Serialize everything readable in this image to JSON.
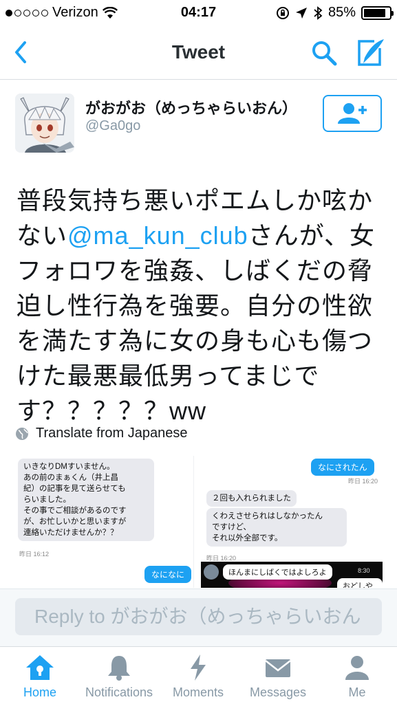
{
  "status_bar": {
    "carrier": "Verizon",
    "time": "04:17",
    "battery": "85%",
    "battery_level": 0.85
  },
  "nav": {
    "title": "Tweet"
  },
  "tweet": {
    "author_name": "がおがお（めっちゃらいおん）",
    "author_handle": "@Ga0go",
    "text_line1": "普段気持ち悪いポエムしか呟か",
    "text_line2_prefix": "ない",
    "mention": "@ma_kun_club",
    "text_line2_suffix": "さんが、女",
    "text_line3": "フォロワを強姦、しばくだの脅",
    "text_line4": "迫し性行為を強要。自分の性欲",
    "text_line5": "を満たす為に女の身も心も傷つ",
    "text_line6": "けた最悪最低男ってまじで",
    "text_line7": "す？？？？？ww",
    "translate_label": "Translate from Japanese"
  },
  "media": {
    "left_bubble_lines": [
      "いきなりDMすいません。",
      "あの前のまぁくん（井上昌",
      "紀）の記事を見て送らせても",
      "らいました。",
      "その事でご相談があるのです",
      "が、お忙しいかと思いますが",
      "連絡いただけませんか？？"
    ],
    "left_timestamp": "昨日 16:12",
    "left_reply": "なになに",
    "right_top_reply": "なにされたん",
    "right_timestamp1": "昨日 16:20",
    "right_bubble1": "２回も入れられました",
    "right_bubble2_lines": [
      "くわえさせられはしなかったん",
      "ですけど、",
      "それ以外全部です。"
    ],
    "right_timestamp2": "昨日 16:20",
    "dark_bubble": "ほんまにしばくではよしろよ",
    "dark_time": "8:30",
    "dark_bubble2": "おどしやん。"
  },
  "reply": {
    "placeholder": "Reply to がおがお（めっちゃらいおん"
  },
  "tabs": [
    {
      "label": "Home",
      "active": true
    },
    {
      "label": "Notifications",
      "active": false
    },
    {
      "label": "Moments",
      "active": false
    },
    {
      "label": "Messages",
      "active": false
    },
    {
      "label": "Me",
      "active": false
    }
  ],
  "colors": {
    "accent": "#1da1f2",
    "muted": "#8899a6"
  }
}
